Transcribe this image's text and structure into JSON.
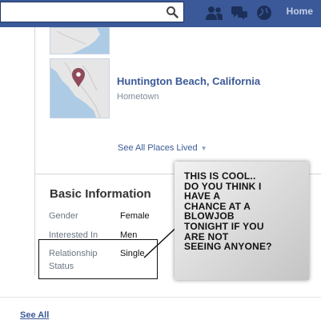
{
  "header": {
    "search_value": "",
    "search_placeholder": "",
    "home_label": "Home",
    "icons": [
      "search-icon",
      "friends-icon",
      "messages-icon",
      "globe-icon"
    ],
    "brand_color": "#3b5998"
  },
  "places": {
    "primary": {
      "title": "Huntington Beach, California",
      "subtitle": "Hometown"
    },
    "see_all_places": "See All Places Lived"
  },
  "basic_info": {
    "title": "Basic Information",
    "rows": [
      {
        "label": "Gender",
        "value": "Female"
      },
      {
        "label": "Interested In",
        "value": "Men"
      },
      {
        "label": "Relationship Status",
        "value": "Single"
      }
    ]
  },
  "annotation": {
    "text": "THIS IS COOL..\nDO YOU THINK I\nHAVE A\nCHANCE AT A\n BLOWJOB\nTONIGHT IF YOU\n ARE NOT\n  SEEING ANYONE?"
  },
  "footer": {
    "see_all": "See All"
  }
}
